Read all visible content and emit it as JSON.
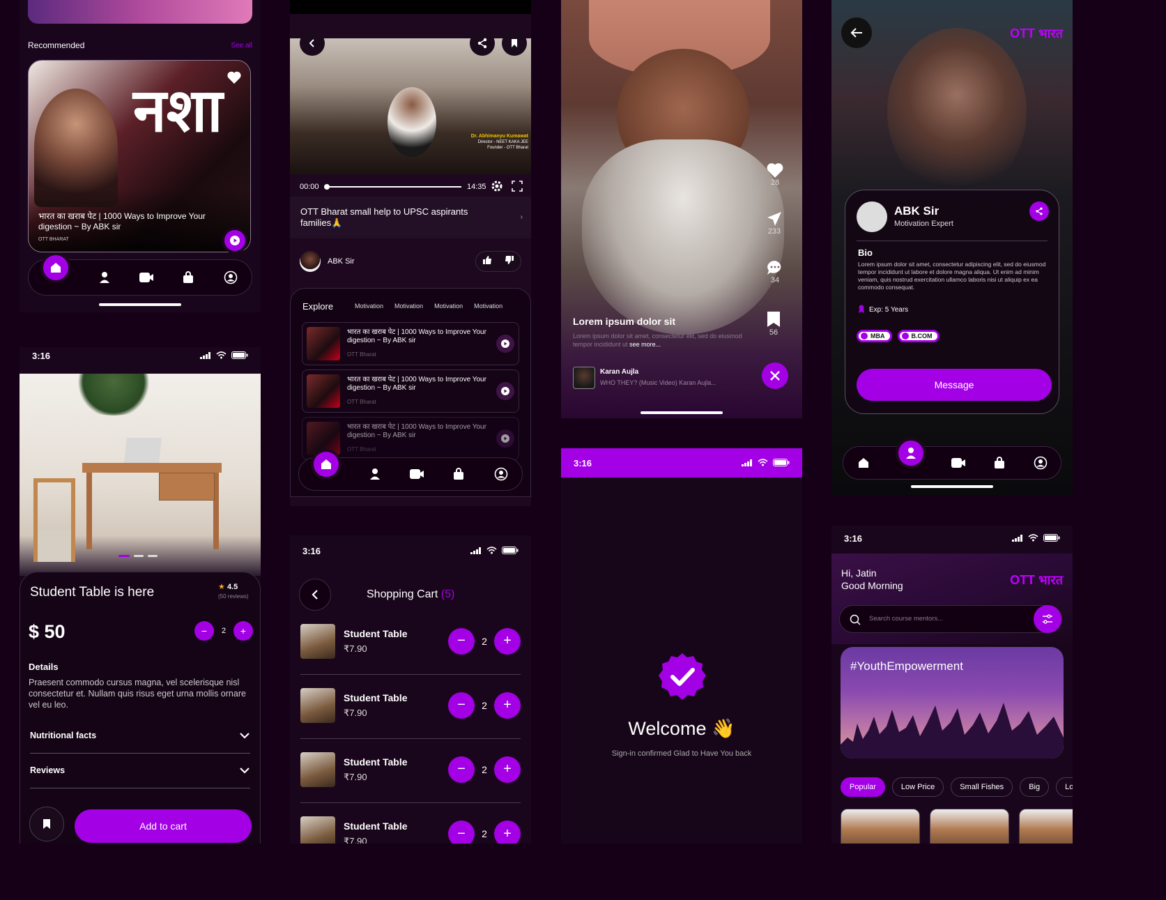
{
  "status_time": "3:16",
  "ott_logo": "OTT भारत",
  "home_feed": {
    "section_title": "Recommended",
    "see_all": "See all",
    "card_title": "भारत का खराब पेट | 1000 Ways to Improve Your digestion ~ By ABK sir",
    "card_caption": "OTT BHARAT",
    "thumb_text": "नशा"
  },
  "video_player": {
    "time_start": "00:00",
    "time_end": "14:35",
    "video_title": "OTT Bharat small help to UPSC aspirants families🙏",
    "channel": "ABK Sir",
    "overlay_name": "Dr. Abhimanyu Kumawat",
    "overlay_role1": "Director - NEET KAKA JEE",
    "overlay_role2": "Founder - OTT Bharat",
    "explore_label": "Explore",
    "chips": [
      "Motivation",
      "Motivation",
      "Motivation",
      "Motivation"
    ],
    "items": [
      {
        "title": "भारत का खराब पेट | 1000 Ways to Improve Your digestion ~ By ABK sir",
        "sub": "OTT Bharat"
      },
      {
        "title": "भारत का खराब पेट | 1000 Ways to Improve Your digestion ~ By ABK sir",
        "sub": "OTT Bharat"
      },
      {
        "title": "भारत का खराब पेट | 1000 Ways to Improve Your digestion ~ By ABK sir",
        "sub": "OTT Bharat"
      }
    ]
  },
  "reel": {
    "likes": "28",
    "shares": "233",
    "comments": "34",
    "saves": "56",
    "caption_title": "Lorem ipsum dolor sit",
    "caption_body": "Lorem ipsum dolor sit amet, consectetur elit, sed do eiusmod tempor incididunt ut",
    "see_more": "see more...",
    "user_name": "Karan Aujla",
    "music": "WHO THEY? (Music Video) Karan Aujla..."
  },
  "profile": {
    "name": "ABK Sir",
    "role": "Motivation Expert",
    "bio_label": "Bio",
    "bio": "Lorem ipsum dolor sit amet, consectetur adipiscing elit, sed do eiusmod tempor incididunt ut labore et dolore magna aliqua. Ut enim ad minim veniam, quis nostrud exercitation ullamco laboris nisi ut aliquip ex ea commodo consequat.",
    "exp": "Exp: 5 Years",
    "tags": [
      "MBA",
      "B.COM"
    ],
    "message_btn": "Message"
  },
  "product": {
    "title": "Student Table  is here",
    "rating": "4.5",
    "reviews_count": "(50 reviews)",
    "price": "$ 50",
    "qty": "2",
    "details_label": "Details",
    "details": "Praesent commodo cursus magna, vel scelerisque nisl consectetur et. Nullam quis risus eget urna mollis ornare vel eu leo.",
    "acc1": "Nutritional facts",
    "acc2": "Reviews",
    "add_to_cart": "Add to cart"
  },
  "cart": {
    "title": "Shopping Cart",
    "count": "(5)",
    "items": [
      {
        "name": "Student Table",
        "price": "₹7.90",
        "qty": "2"
      },
      {
        "name": "Student Table",
        "price": "₹7.90",
        "qty": "2"
      },
      {
        "name": "Student Table",
        "price": "₹7.90",
        "qty": "2"
      },
      {
        "name": "Student Table",
        "price": "₹7.90",
        "qty": "2"
      }
    ]
  },
  "welcome": {
    "title": "Welcome 👋",
    "sub": "Sign-in confirmed Glad to Have You back"
  },
  "home2": {
    "greet1": "Hi, Jatin",
    "greet2": "Good Morning",
    "search_placeholder": "Search course mentors...",
    "banner_tag": "#YouthEmpowerment",
    "filters": [
      "Popular",
      "Low Price",
      "Small Fishes",
      "Big",
      "Low P"
    ]
  }
}
